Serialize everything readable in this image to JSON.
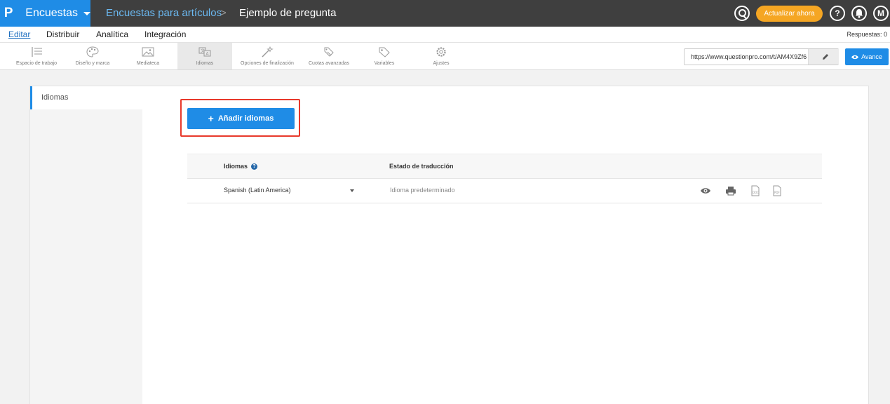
{
  "topbar": {
    "logo": "P",
    "product": "Encuestas",
    "breadcrumb_parent": "Encuestas para artículos",
    "breadcrumb_sep": ">",
    "breadcrumb_current": "Ejemplo de pregunta",
    "upgrade_label": "Actualizar ahora",
    "help_label": "?",
    "avatar_label": "M"
  },
  "nav": {
    "items": [
      "Editar",
      "Distribuir",
      "Analítica",
      "Integración"
    ],
    "responses": "Respuestas: 0"
  },
  "toolbar": {
    "tools": [
      "Espacio de trabajo",
      "Diseño y marca",
      "Mediateca",
      "Idiomas",
      "Opciones de finalización",
      "Cuotas avanzadas",
      "Variables",
      "Ajustes"
    ],
    "url": "https://www.questionpro.com/t/AM4X9Zf6",
    "preview_label": "Avance"
  },
  "sidebar": {
    "item": "Idiomas"
  },
  "main": {
    "add_button": "Añadir idiomas",
    "col_languages": "Idiomas",
    "col_status": "Estado de traducción",
    "row_language": "Spanish (Latin America)",
    "row_status": "Idioma predeterminado",
    "doc_label": "DOC",
    "pdf_label": "PDF"
  },
  "colors": {
    "accent": "#1f8ce6",
    "topbar": "#3f3f3f",
    "upgrade": "#f5a623",
    "highlight": "#e8392b"
  }
}
